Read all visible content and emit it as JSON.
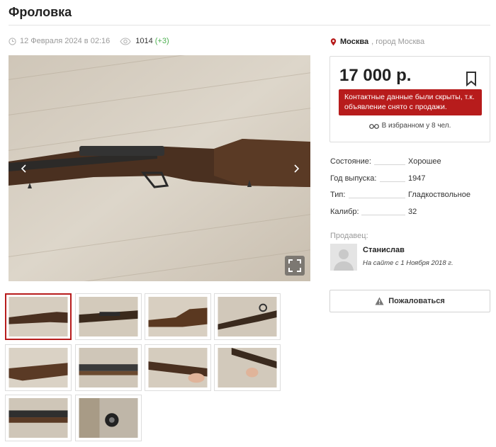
{
  "page": {
    "title": "Фроловка"
  },
  "meta": {
    "date": "12 Февраля 2024 в 02:16",
    "views": "1014",
    "views_new": "(+3)"
  },
  "gallery": {
    "prev_icon": "chevron-left-icon",
    "next_icon": "chevron-right-icon",
    "fullscreen_icon": "fullscreen-icon",
    "thumbnail_count": 10,
    "active_thumbnail": 1
  },
  "location": {
    "city": "Москва",
    "sub": ", город Москва"
  },
  "price_box": {
    "price": "17 000 р.",
    "alert": "Контактные данные были скрыты, т.к. объявление снято с продажи.",
    "favorites": "В избранном у 8 чел.",
    "alert_color": "#b71c1c"
  },
  "properties": [
    {
      "key": "Состояние:",
      "value": "Хорошее"
    },
    {
      "key": "Год выпуска:",
      "value": "1947"
    },
    {
      "key": "Тип:",
      "value": "Гладкоствольное"
    },
    {
      "key": "Калибр:",
      "value": "32"
    }
  ],
  "seller": {
    "label": "Продавец:",
    "name": "Станислав",
    "since": "На сайте с 1 Ноября 2018 г."
  },
  "actions": {
    "complain": "Пожаловаться"
  }
}
